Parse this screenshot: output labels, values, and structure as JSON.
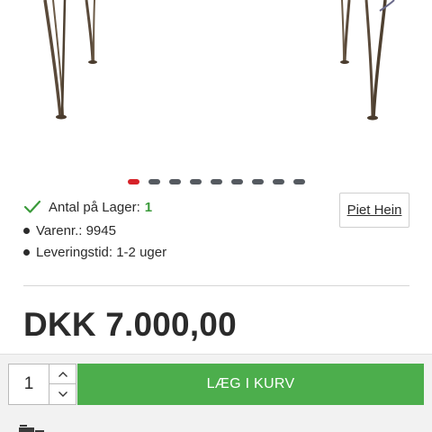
{
  "product": {
    "image_alt": "chair-legs-photo"
  },
  "carousel": {
    "total_slides": 9,
    "active_slide": 1
  },
  "stock": {
    "label": "Antal på Lager:",
    "count": "1",
    "icon": "check-icon"
  },
  "specs": {
    "sku": "Varenr.: 9945",
    "lead_time": "Leveringstid: 1-2 uger"
  },
  "brand": {
    "label": "Piet Hein"
  },
  "price": {
    "text": "DKK 7.000,00"
  },
  "cart": {
    "quantity": "1",
    "add_label": "LÆG I KURV"
  },
  "icons": {
    "truck": "truck-icon",
    "step_up": "chevron-up-icon",
    "step_down": "chevron-down-icon"
  },
  "colors": {
    "accent_green": "#4cae4c",
    "stock_green": "#3a9a3a",
    "active_dot": "#d62229",
    "dot": "#555a60",
    "text": "#2b2b2b"
  }
}
